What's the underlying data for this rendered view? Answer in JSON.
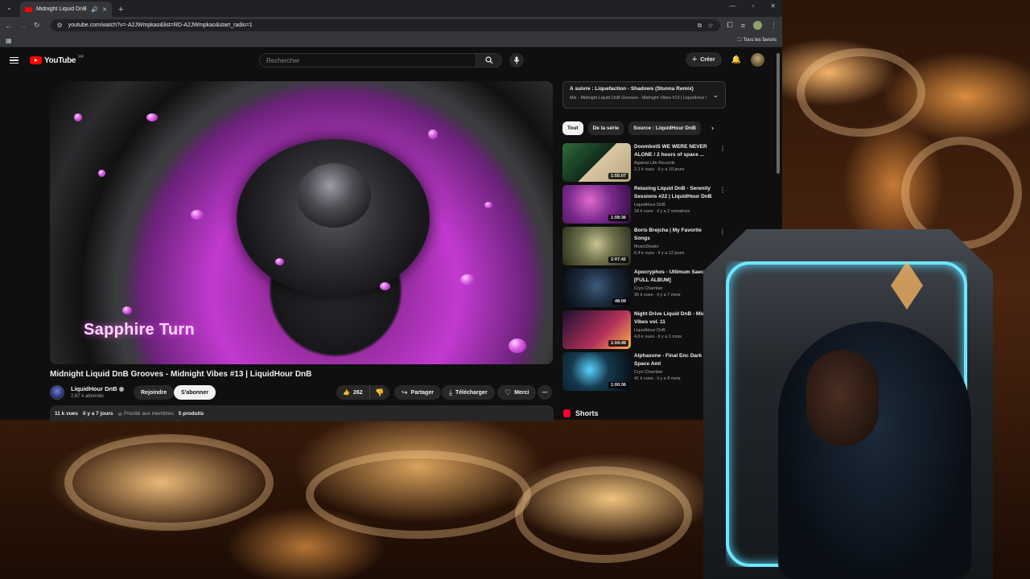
{
  "browser": {
    "tab_title": "Midnight Liquid DnB Groo",
    "url": "youtube.com/watch?v=-A2JWmpkao&list=RD-A2JWmpkao&start_radio=1",
    "bookmarks_folder": "Tous les favoris"
  },
  "masthead": {
    "logo": "YouTube",
    "region": "FR",
    "search_placeholder": "Rechercher",
    "create_label": "Créer"
  },
  "player": {
    "overlay_text": "Sapphire Turn"
  },
  "video": {
    "title": "Midnight Liquid DnB Grooves - Midnight Vibes #13 | LiquidHour DnB",
    "channel": "LiquidHour DnB",
    "subscribers": "2,67 k abonnés",
    "join_label": "Rejoindre",
    "subscribe_label": "S'abonner",
    "likes": "262",
    "share_label": "Partager",
    "download_label": "Télécharger",
    "thanks_label": "Merci",
    "views": "11 k vues",
    "date": "il y a 7 jours",
    "members_priority": "Priorité aux membres",
    "products": "5 produits"
  },
  "up_next": {
    "title": "À suivre : Liquefaction - Shadows (Stunna Remix)",
    "subtitle": "Mix - Midnight Liquid DnB Grooves - Midnight Vibes #13 | LiquidHour DnB"
  },
  "chips": [
    "Tout",
    "De la série",
    "Source : LiquidHour DnB"
  ],
  "recommendations": [
    {
      "title": "DoombotS  WE WERE NEVER ALONE / 2 hours of space ...",
      "channel": "Against Life Records",
      "meta": "2,1 k vues · il y a 10 jours",
      "duration": "1:55:07",
      "thumb_color": "#2f6b3a"
    },
    {
      "title": "Relaxing Liquid DnB - Serenity Sessions #22 | LiquidHour DnB",
      "channel": "LiquidHour DnB",
      "meta": "18 k vues · il y a 2 semaines",
      "duration": "1:08:36",
      "thumb_color": "#7b2a8e"
    },
    {
      "title": "Boris Brejcha | My Favorite Songs",
      "channel": "MusicDealer",
      "meta": "6,4 k vues · il y a 12 jours",
      "duration": "2:07:42",
      "thumb_color": "#6b6f4a"
    },
    {
      "title": "Apocryphos - Ultimum Saeculum [FULL ALBUM]",
      "channel": "Cryo Chamber",
      "meta": "26 k vues · il y a 7 mois",
      "duration": "48:09",
      "thumb_color": "#1d2a3c"
    },
    {
      "title": "Night Drive Liquid DnB - Midnight Vibes vol. 11",
      "channel": "LiquidHour DnB",
      "meta": "4,6 k vues · il y a 1 mois",
      "duration": "1:04:49",
      "thumb_color": "#b2305a"
    },
    {
      "title": "Alphaxone - Final Enc Dark Deep Space Aml",
      "channel": "Cryo Chamber",
      "meta": "41 k vues · il y a 8 mois",
      "duration": "1:00:36",
      "thumb_color": "#163a4e"
    }
  ],
  "shorts_label": "Shorts"
}
